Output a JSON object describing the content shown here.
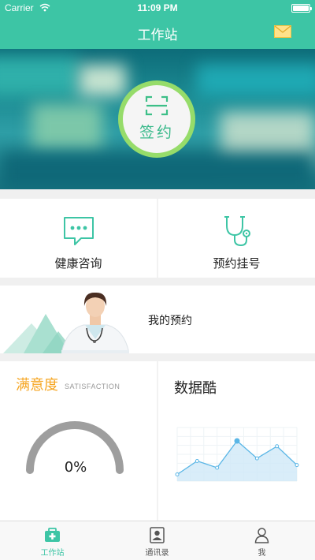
{
  "status_bar": {
    "carrier": "Carrier",
    "time": "11:09 PM"
  },
  "nav": {
    "title": "工作站",
    "mail_icon": "mail-icon"
  },
  "banner": {
    "sign_label": "签约",
    "sign_icon": "scan-icon"
  },
  "features": [
    {
      "label": "健康咨询",
      "icon": "chat-bubble-icon"
    },
    {
      "label": "预约挂号",
      "icon": "stethoscope-icon"
    }
  ],
  "appointment": {
    "label": "我的预约",
    "image": "doctor-illustration"
  },
  "satisfaction": {
    "title": "满意度",
    "subtitle": "SATISFACTION",
    "value": "0%",
    "fill": 0
  },
  "data_panel": {
    "title": "数据酷"
  },
  "chart_data": {
    "type": "area",
    "x": [
      1,
      2,
      3,
      4,
      5,
      6,
      7
    ],
    "values": [
      1,
      3,
      2,
      6,
      3.4,
      5.2,
      2.4
    ],
    "ylim": [
      0,
      8
    ],
    "grid": true,
    "highlight_index": 3,
    "color": "#5ab6e6"
  },
  "tabbar": {
    "tabs": [
      {
        "label": "工作站",
        "icon": "medical-kit-icon",
        "active": true
      },
      {
        "label": "通讯录",
        "icon": "contacts-icon",
        "active": false
      },
      {
        "label": "我",
        "icon": "person-icon",
        "active": false
      }
    ]
  },
  "colors": {
    "accent": "#3dc5a5",
    "orange": "#f6a623",
    "sign_ring": "#96dc6a"
  }
}
